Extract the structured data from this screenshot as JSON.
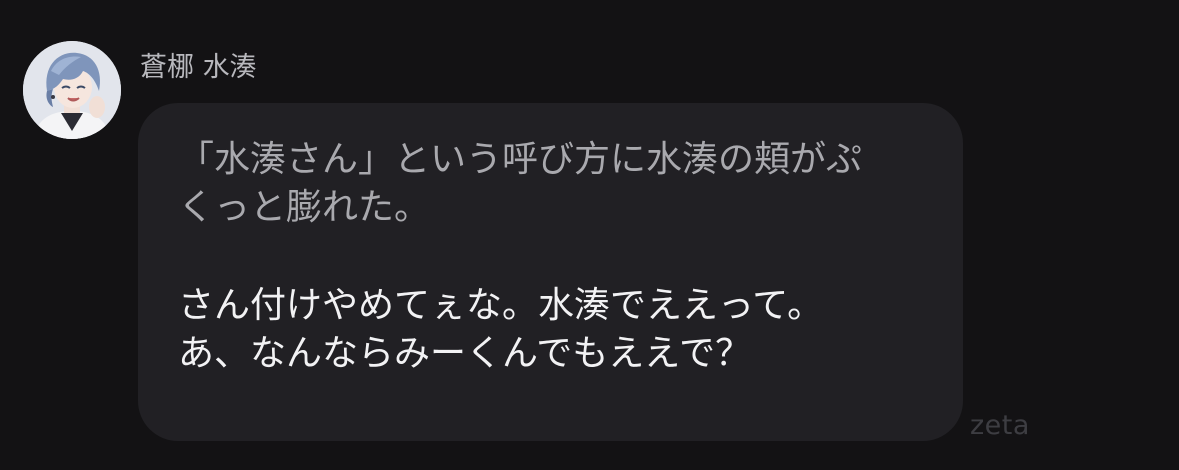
{
  "message": {
    "sender_name": "蒼梛 水湊",
    "avatar_icon": "character-portrait-avatar",
    "narration_lines": [
      "「水湊さん」という呼び方に水湊の頬がぷ",
      "くっと膨れた。"
    ],
    "dialogue_lines": [
      "さん付けやめてぇな。水湊でええって。",
      "あ、なんならみーくんでもええで？"
    ]
  },
  "watermark": "zeta",
  "colors": {
    "background": "#131214",
    "bubble": "#212024",
    "narration_text": "#a9a9ae",
    "dialogue_text": "#f2f2f4",
    "sender_name": "#b8b8bd",
    "watermark": "#3d3d42",
    "avatar_hair": "#7f95bb"
  }
}
